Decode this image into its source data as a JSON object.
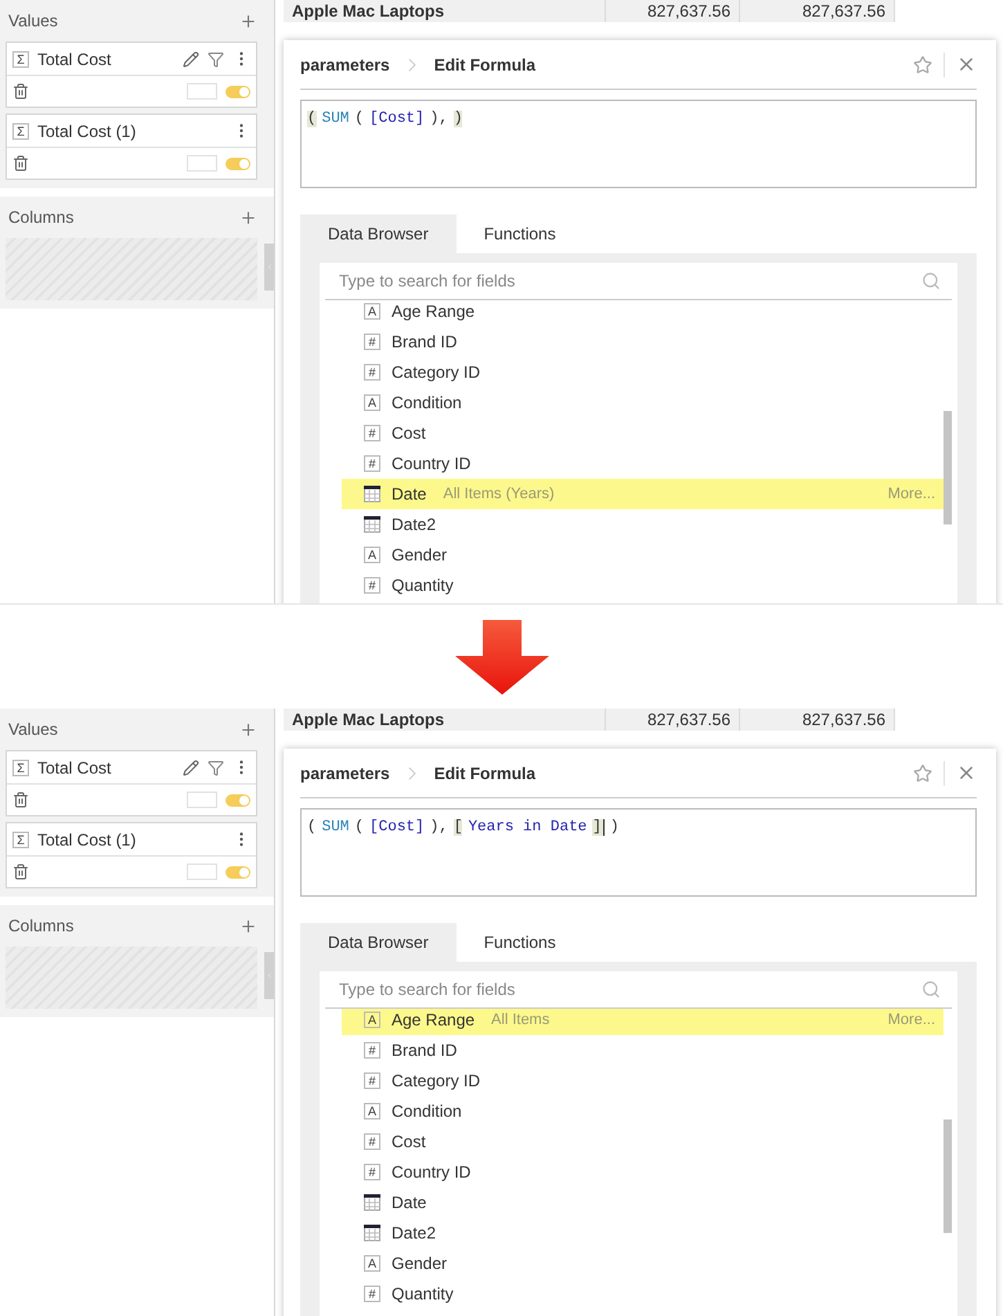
{
  "panels": [
    {
      "sidebar": {
        "values": {
          "title": "Values",
          "measures": [
            {
              "icon": "Σ",
              "name": "Total Cost",
              "editable": true,
              "on": true
            },
            {
              "icon": "Σ",
              "name": "Total Cost (1)",
              "editable": false,
              "on": true
            }
          ]
        },
        "columns": {
          "title": "Columns"
        }
      },
      "table": {
        "rows": [
          {
            "label": "Apple Mac Laptops",
            "values": [
              "827,637.56",
              "827,637.56"
            ]
          }
        ]
      },
      "dialog": {
        "breadcrumb": [
          "parameters",
          "Edit Formula"
        ],
        "formula": [
          {
            "text": "(",
            "kind": "punct",
            "matched": true,
            "caret": false
          },
          {
            "text": "SUM",
            "kind": "function",
            "matched": false,
            "caret": false
          },
          {
            "text": "(",
            "kind": "punct",
            "matched": false,
            "caret": false
          },
          {
            "text": "[Cost]",
            "kind": "field",
            "matched": false,
            "caret": false
          },
          {
            "text": "),",
            "kind": "punct",
            "matched": false,
            "caret": false
          },
          {
            "text": ")",
            "kind": "punct",
            "matched": true,
            "caret": false
          }
        ],
        "tabs": [
          {
            "label": "Data Browser",
            "selected": true
          },
          {
            "label": "Functions",
            "selected": false
          }
        ],
        "search": {
          "placeholder": "Type to search for fields"
        },
        "fields": [
          {
            "name": "Age Range",
            "kind": "text",
            "icon": "A",
            "selected": false
          },
          {
            "name": "Brand ID",
            "kind": "number",
            "icon": "#",
            "selected": false
          },
          {
            "name": "Category ID",
            "kind": "number",
            "icon": "#",
            "selected": false
          },
          {
            "name": "Condition",
            "kind": "text",
            "icon": "A",
            "selected": false
          },
          {
            "name": "Cost",
            "kind": "number",
            "icon": "#",
            "selected": false
          },
          {
            "name": "Country ID",
            "kind": "number",
            "icon": "#",
            "selected": false
          },
          {
            "name": "Date",
            "kind": "date",
            "selected": true,
            "detail": "All Items (Years)",
            "more": "More..."
          },
          {
            "name": "Date2",
            "kind": "date",
            "selected": false
          },
          {
            "name": "Gender",
            "kind": "text",
            "icon": "A",
            "selected": false
          },
          {
            "name": "Quantity",
            "kind": "number",
            "icon": "#",
            "selected": false
          }
        ]
      }
    },
    {
      "sidebar": {
        "values": {
          "title": "Values",
          "measures": [
            {
              "icon": "Σ",
              "name": "Total Cost",
              "editable": true,
              "on": true
            },
            {
              "icon": "Σ",
              "name": "Total Cost (1)",
              "editable": false,
              "on": true
            }
          ]
        },
        "columns": {
          "title": "Columns"
        }
      },
      "table": {
        "rows": [
          {
            "label": "Apple Mac Laptops",
            "values": [
              "827,637.56",
              "827,637.56"
            ]
          }
        ]
      },
      "dialog": {
        "breadcrumb": [
          "parameters",
          "Edit Formula"
        ],
        "formula": [
          {
            "text": "(",
            "kind": "punct",
            "matched": false,
            "caret": false
          },
          {
            "text": "SUM",
            "kind": "function",
            "matched": false,
            "caret": false
          },
          {
            "text": "(",
            "kind": "punct",
            "matched": false,
            "caret": false
          },
          {
            "text": "[Cost]",
            "kind": "field",
            "matched": false,
            "caret": false
          },
          {
            "text": "),",
            "kind": "punct",
            "matched": false,
            "caret": false
          },
          {
            "text": "[",
            "kind": "punct",
            "matched": true,
            "caret": false
          },
          {
            "text": "Years in Date",
            "kind": "field",
            "matched": false,
            "caret": false
          },
          {
            "text": "]",
            "kind": "punct",
            "matched": true,
            "caret": true
          },
          {
            "text": ")",
            "kind": "punct",
            "matched": false,
            "caret": false
          }
        ],
        "tabs": [
          {
            "label": "Data Browser",
            "selected": true
          },
          {
            "label": "Functions",
            "selected": false
          }
        ],
        "search": {
          "placeholder": "Type to search for fields"
        },
        "fields": [
          {
            "name": "Age Range",
            "kind": "text",
            "icon": "A",
            "selected": true,
            "detail": "All Items",
            "more": "More..."
          },
          {
            "name": "Brand ID",
            "kind": "number",
            "icon": "#",
            "selected": false
          },
          {
            "name": "Category ID",
            "kind": "number",
            "icon": "#",
            "selected": false
          },
          {
            "name": "Condition",
            "kind": "text",
            "icon": "A",
            "selected": false
          },
          {
            "name": "Cost",
            "kind": "number",
            "icon": "#",
            "selected": false
          },
          {
            "name": "Country ID",
            "kind": "number",
            "icon": "#",
            "selected": false
          },
          {
            "name": "Date",
            "kind": "date",
            "selected": false
          },
          {
            "name": "Date2",
            "kind": "date",
            "selected": false
          },
          {
            "name": "Gender",
            "kind": "text",
            "icon": "A",
            "selected": false
          },
          {
            "name": "Quantity",
            "kind": "number",
            "icon": "#",
            "selected": false
          }
        ]
      }
    }
  ]
}
